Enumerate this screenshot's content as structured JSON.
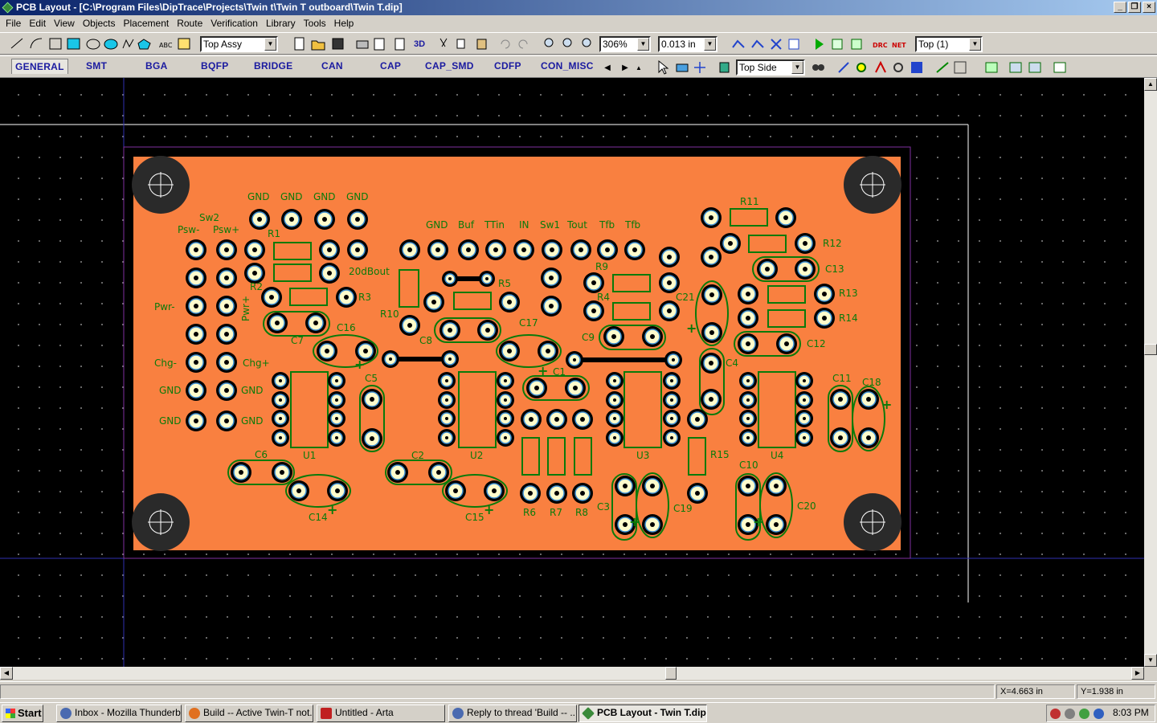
{
  "window": {
    "title": "PCB Layout - [C:\\Program Files\\DipTrace\\Projects\\Twin t\\Twin T outboard\\Twin T.dip]"
  },
  "menu": [
    "File",
    "Edit",
    "View",
    "Objects",
    "Placement",
    "Route",
    "Verification",
    "Library",
    "Tools",
    "Help"
  ],
  "toolbar": {
    "layer_mode": "Top Assy",
    "btn_3d": "3D",
    "zoom": "306%",
    "grid": "0.013 in",
    "layer": "Top (1)"
  },
  "libraries": [
    "GENERAL",
    "SMT",
    "BGA",
    "BQFP",
    "BRIDGE",
    "CAN",
    "CAP",
    "CAP_SMD",
    "CDFP",
    "CON_MISC"
  ],
  "toolbar2": {
    "side": "Top Side"
  },
  "status": {
    "x": "X=4.663 in",
    "y": "Y=1.938 in"
  },
  "taskbar": {
    "start": "Start",
    "tasks": [
      "Inbox - Mozilla Thunderbird",
      "Build -- Active Twin-T not...",
      "Untitled - Arta",
      "Reply to thread 'Build -- ...",
      "PCB Layout - Twin T.dip"
    ],
    "clock": "8:03 PM"
  },
  "colors": {
    "board": "#f98040",
    "silk": "#0a7a0a",
    "pad": "#fffccc",
    "via": "#3f8fd0",
    "background": "#000000"
  },
  "board": {
    "labels": {
      "gnd1": "GND",
      "gnd2": "GND",
      "gnd3": "GND",
      "gnd4": "GND",
      "sw2": "Sw2",
      "psw_minus": "Psw-",
      "psw_plus": "Psw+",
      "pwr_minus": "Pwr-",
      "pwr_plus": "Pwr+",
      "chg_minus": "Chg-",
      "chg_plus": "Chg+",
      "gnd_l1": "GND",
      "gnd_l2": "GND",
      "gnd_r1": "GND",
      "gnd_r2": "GND",
      "gnd_top": "GND",
      "buf": "Buf",
      "ttin": "TTin",
      "in": "IN",
      "sw1": "Sw1",
      "tout": "Tout",
      "tfb1": "Tfb",
      "tfb2": "Tfb",
      "out20db": "20dBout",
      "r1": "R1",
      "r2": "R2",
      "r3": "R3",
      "r4": "R4",
      "r5": "R5",
      "r6": "R6",
      "r7": "R7",
      "r8": "R8",
      "r9": "R9",
      "r10": "R10",
      "r11": "R11",
      "r12": "R12",
      "r13": "R13",
      "r14": "R14",
      "r15": "R15",
      "c1": "C1",
      "c2": "C2",
      "c3": "C3",
      "c4": "C4",
      "c5": "C5",
      "c6": "C6",
      "c7": "C7",
      "c8": "C8",
      "c9": "C9",
      "c10": "C10",
      "c11": "C11",
      "c12": "C12",
      "c13": "C13",
      "c14": "C14",
      "c15": "C15",
      "c16": "C16",
      "c17": "C17",
      "c18": "C18",
      "c19": "C19",
      "c20": "C20",
      "c21": "C21",
      "u1": "U1",
      "u2": "U2",
      "u3": "U3",
      "u4": "U4"
    }
  }
}
